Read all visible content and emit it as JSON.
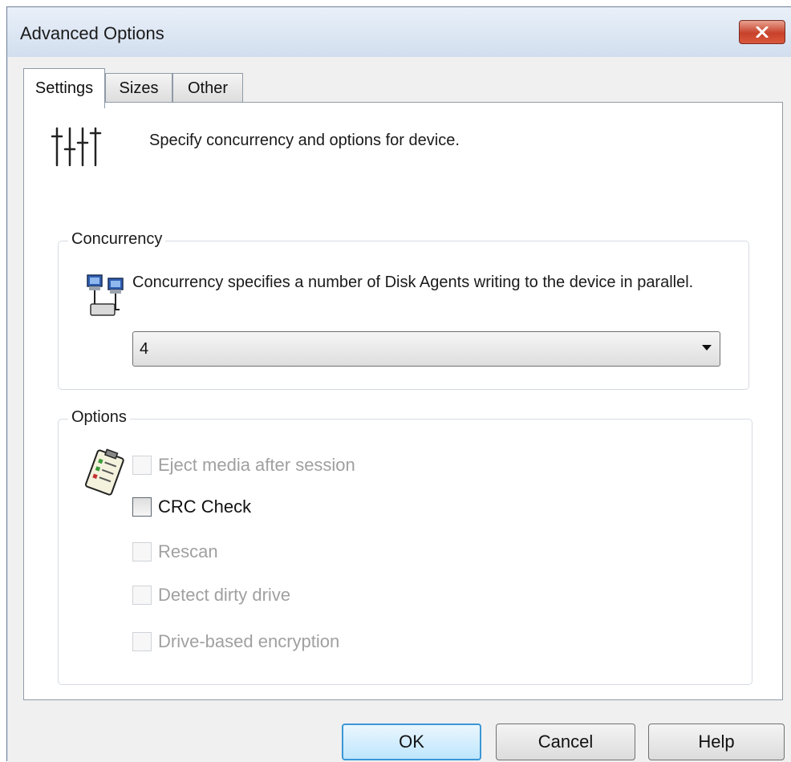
{
  "window": {
    "title": "Advanced Options"
  },
  "tabs": [
    {
      "label": "Settings",
      "active": true
    },
    {
      "label": "Sizes",
      "active": false
    },
    {
      "label": "Other",
      "active": false
    }
  ],
  "settings": {
    "description": "Specify concurrency and options for device.",
    "concurrency": {
      "group_label": "Concurrency",
      "description": "Concurrency specifies a number of Disk Agents writing to the device in parallel.",
      "selected_value": "4"
    },
    "options": {
      "group_label": "Options",
      "items": [
        {
          "label": "Eject media after session",
          "checked": false,
          "enabled": false
        },
        {
          "label": "CRC Check",
          "checked": false,
          "enabled": true
        },
        {
          "label": "Rescan",
          "checked": false,
          "enabled": false
        },
        {
          "label": "Detect dirty drive",
          "checked": false,
          "enabled": false
        },
        {
          "label": "Drive-based encryption",
          "checked": false,
          "enabled": false
        }
      ]
    }
  },
  "buttons": {
    "ok": "OK",
    "cancel": "Cancel",
    "help": "Help"
  },
  "icons": {
    "close": "close-icon",
    "settings": "sliders-icon",
    "concurrency": "network-computers-icon",
    "options": "checklist-icon"
  }
}
